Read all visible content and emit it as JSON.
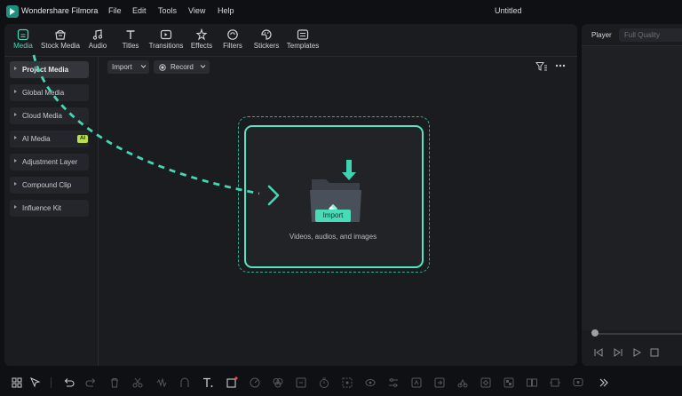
{
  "app": {
    "name": "Wondershare Filmora",
    "document_title": "Untitled"
  },
  "menu": [
    "File",
    "Edit",
    "Tools",
    "View",
    "Help"
  ],
  "tabs": [
    {
      "label": "Media",
      "icon": "media-icon",
      "active": true
    },
    {
      "label": "Stock Media",
      "icon": "stock-media-icon",
      "active": false
    },
    {
      "label": "Audio",
      "icon": "audio-icon",
      "active": false
    },
    {
      "label": "Titles",
      "icon": "titles-icon",
      "active": false
    },
    {
      "label": "Transitions",
      "icon": "transitions-icon",
      "active": false
    },
    {
      "label": "Effects",
      "icon": "effects-icon",
      "active": false
    },
    {
      "label": "Filters",
      "icon": "filters-icon",
      "active": false
    },
    {
      "label": "Stickers",
      "icon": "stickers-icon",
      "active": false
    },
    {
      "label": "Templates",
      "icon": "templates-icon",
      "active": false
    }
  ],
  "sidebar": {
    "items": [
      {
        "label": "Project Media",
        "active": true
      },
      {
        "label": "Global Media"
      },
      {
        "label": "Cloud Media"
      },
      {
        "label": "AI Media",
        "badge": "AI"
      },
      {
        "label": "Adjustment Layer"
      },
      {
        "label": "Compound Clip"
      },
      {
        "label": "Influence Kit"
      }
    ]
  },
  "media_toolbar": {
    "import_label": "Import",
    "record_label": "Record"
  },
  "dropzone": {
    "button_label": "Import",
    "hint": "Videos, audios, and images"
  },
  "player": {
    "label": "Player",
    "quality": "Full Quality"
  },
  "colors": {
    "accent": "#46d6b6",
    "panel": "#1b1c20",
    "background": "#0f1013",
    "ai_badge": "#b9e04a"
  },
  "bottom_toolbar_icons": [
    "layout-icon",
    "select-tool-icon",
    "undo-icon",
    "redo-icon",
    "delete-icon",
    "cut-icon",
    "audio-detach-icon",
    "audio-stretch-icon",
    "text-icon",
    "crop-icon",
    "speed-icon",
    "color-icon",
    "mark-icon",
    "timer-icon",
    "freeze-icon",
    "mask-icon",
    "adjust-icon",
    "ai-cutout-icon",
    "export-frame-icon",
    "motion-icon",
    "keyframe-icon",
    "mosaic-icon",
    "split-icon",
    "stabilize-icon",
    "more-icon"
  ]
}
